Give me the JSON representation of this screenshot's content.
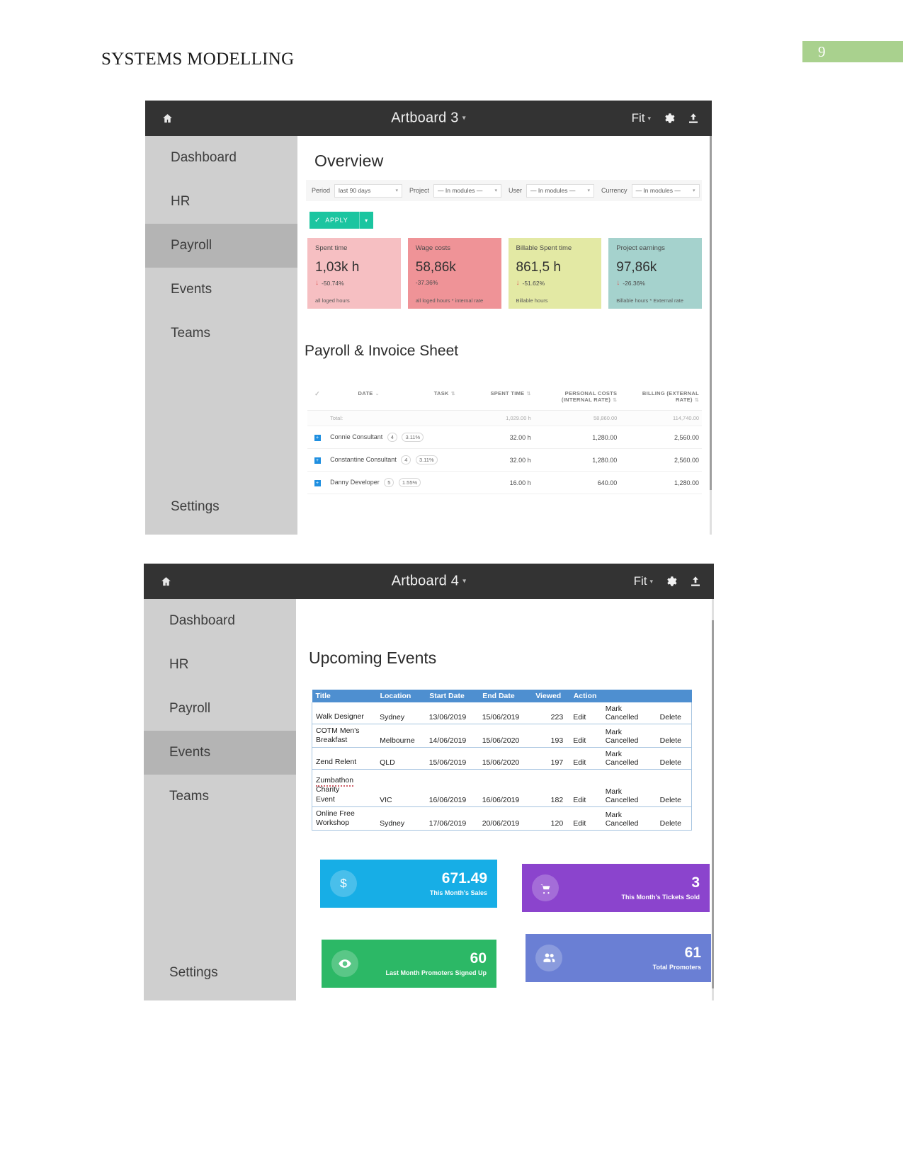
{
  "document": {
    "title": "SYSTEMS MODELLING",
    "page_number": "9"
  },
  "artboard3": {
    "topbar": {
      "home_icon": "home-icon",
      "title": "Artboard 3",
      "caret": "▾",
      "zoom_label": "Fit",
      "zoom_caret": "▾",
      "settings_icon": "gear-icon",
      "share_icon": "upload-icon"
    },
    "sidebar": {
      "items": [
        {
          "label": "Dashboard",
          "active": false
        },
        {
          "label": "HR",
          "active": false
        },
        {
          "label": "Payroll",
          "active": true
        },
        {
          "label": "Events",
          "active": false
        },
        {
          "label": "Teams",
          "active": false
        }
      ],
      "settings_label": "Settings"
    },
    "overview": {
      "heading": "Overview",
      "filters": [
        {
          "label": "Period",
          "value": "last 90 days"
        },
        {
          "label": "Project",
          "value": "— In modules —"
        },
        {
          "label": "User",
          "value": "— In modules —"
        },
        {
          "label": "Currency",
          "value": "— In modules —"
        }
      ],
      "apply_label": "APPLY",
      "apply_check": "✓",
      "apply_caret": "▾",
      "kpis": [
        {
          "label": "Spent time",
          "value": "1,03k h",
          "delta": "-50.74%",
          "arrow": "↓",
          "footnote": "all loged hours",
          "bg": "#f6bfc2",
          "show_arrow": true
        },
        {
          "label": "Wage costs",
          "value": "58,86k",
          "delta": "-37.36%",
          "arrow": "↓",
          "footnote": "all loged hours * internal rate",
          "bg": "#ef9397",
          "show_arrow": false
        },
        {
          "label": "Billable Spent time",
          "value": "861,5 h",
          "delta": "-51.62%",
          "arrow": "↓",
          "footnote": "Billable hours",
          "bg": "#e3e9a4",
          "show_arrow": true
        },
        {
          "label": "Project earnings",
          "value": "97,86k",
          "delta": "-26.36%",
          "arrow": "↓",
          "footnote": "Billable hours * External rate",
          "bg": "#a5d2cd",
          "show_arrow": true
        }
      ]
    },
    "payroll_sheet": {
      "heading": "Payroll & Invoice Sheet",
      "check_header": "✓",
      "columns": [
        "DATE",
        "TASK",
        "SPENT TIME",
        "PERSONAL COSTS (INTERNAL RATE)",
        "BILLING (EXTERNAL RATE)"
      ],
      "total_row": {
        "label": "Total:",
        "spent_time": "1,029.00 h",
        "personal_costs": "58,860.00",
        "billing": "114,740.00"
      },
      "rows": [
        {
          "name": "Connie Consultant",
          "count": "4",
          "percent": "3.11%",
          "spent_time": "32.00 h",
          "personal_costs": "1,280.00",
          "billing": "2,560.00"
        },
        {
          "name": "Constantine Consultant",
          "count": "4",
          "percent": "3.11%",
          "spent_time": "32.00 h",
          "personal_costs": "1,280.00",
          "billing": "2,560.00"
        },
        {
          "name": "Danny Developer",
          "count": "5",
          "percent": "1.55%",
          "spent_time": "16.00 h",
          "personal_costs": "640.00",
          "billing": "1,280.00"
        }
      ]
    }
  },
  "artboard4": {
    "topbar": {
      "home_icon": "home-icon",
      "title": "Artboard 4",
      "caret": "▾",
      "zoom_label": "Fit",
      "zoom_caret": "▾",
      "settings_icon": "gear-icon",
      "share_icon": "upload-icon"
    },
    "sidebar": {
      "items": [
        {
          "label": "Dashboard",
          "active": false
        },
        {
          "label": "HR",
          "active": false
        },
        {
          "label": "Payroll",
          "active": false
        },
        {
          "label": "Events",
          "active": true
        },
        {
          "label": "Teams",
          "active": false
        }
      ],
      "settings_label": "Settings"
    },
    "events": {
      "heading": "Upcoming Events",
      "columns": [
        "Title",
        "Location",
        "Start Date",
        "End Date",
        "Viewed",
        "Action",
        "",
        ""
      ],
      "rows": [
        {
          "title": "Walk Designer",
          "title_line2": "",
          "location": "Sydney",
          "start_date": "13/06/2019",
          "end_date": "15/06/2019",
          "viewed": "223",
          "edit": "Edit",
          "cancel": "Mark Cancelled",
          "delete": "Delete"
        },
        {
          "title": "COTM Men's",
          "title_line2": "Breakfast",
          "location": "Melbourne",
          "start_date": "14/06/2019",
          "end_date": "15/06/2020",
          "viewed": "193",
          "edit": "Edit",
          "cancel": "Mark Cancelled",
          "delete": "Delete"
        },
        {
          "title": "Zend Relent",
          "title_line2": "",
          "location": "QLD",
          "start_date": "15/06/2019",
          "end_date": "15/06/2020",
          "viewed": "197",
          "edit": "Edit",
          "cancel": "Mark Cancelled",
          "delete": "Delete"
        },
        {
          "title": "Zumbathon Charity",
          "title_line2": "Event",
          "location": "VIC",
          "start_date": "16/06/2019",
          "end_date": "16/06/2019",
          "viewed": "182",
          "edit": "Edit",
          "cancel": "Mark Cancelled",
          "delete": "Delete"
        },
        {
          "title": "Online Free",
          "title_line2": "Workshop",
          "location": "Sydney",
          "start_date": "17/06/2019",
          "end_date": "20/06/2019",
          "viewed": "120",
          "edit": "Edit",
          "cancel": "Mark Cancelled",
          "delete": "Delete"
        }
      ]
    },
    "stats": [
      {
        "icon": "dollar-icon",
        "glyph": "$",
        "value": "671.49",
        "caption": "This Month's Sales",
        "bg": "#17aee6"
      },
      {
        "icon": "cart-icon",
        "glyph": "🛒",
        "value": "3",
        "caption": "This Month's Tickets Sold",
        "bg": "#8b44cd"
      },
      {
        "icon": "eye-icon",
        "glyph": "◉",
        "value": "60",
        "caption": "Last Month Promoters Signed Up",
        "bg": "#2cb866"
      },
      {
        "icon": "users-icon",
        "glyph": "👥",
        "value": "61",
        "caption": "Total Promoters",
        "bg": "#6a7fd4"
      }
    ]
  }
}
